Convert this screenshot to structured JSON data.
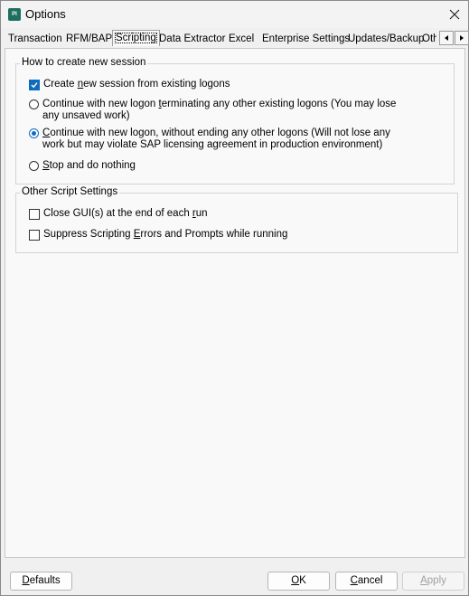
{
  "window": {
    "title": "Options",
    "app_icon_text": "PI"
  },
  "tabs": [
    {
      "label": "Transaction"
    },
    {
      "label": "RFM/BAPI"
    },
    {
      "label": "Scripting"
    },
    {
      "label": "Data Extractor"
    },
    {
      "label": "Excel"
    },
    {
      "label": "Enterprise Settings"
    },
    {
      "label": "Updates/Backup"
    },
    {
      "label": "Oth"
    }
  ],
  "active_tab": "Scripting",
  "session_group": {
    "title": "How to create new session",
    "options": [
      {
        "pre": "Create ",
        "key": "n",
        "post": "ew session from existing logons",
        "type": "checkbox",
        "selected": true
      },
      {
        "pre": "Continue with new logon ",
        "key": "t",
        "post": "erminating any other existing logons (You may lose any unsaved work)",
        "type": "radio",
        "selected": false
      },
      {
        "pre": "",
        "key": "C",
        "post": "ontinue with new logon, without ending any other logons (Will not lose any work but may violate SAP licensing agreement in production environment)",
        "type": "radio",
        "selected": true
      },
      {
        "pre": "",
        "key": "S",
        "post": "top and do nothing",
        "type": "radio",
        "selected": false
      }
    ]
  },
  "script_group": {
    "title": "Other Script Settings",
    "options": [
      {
        "pre": "Close GUI(s) at the end of each ",
        "key": "r",
        "post": "un",
        "checked": false
      },
      {
        "pre": "Suppress Scripting ",
        "key": "E",
        "post": "rrors and Prompts while running",
        "checked": false
      }
    ]
  },
  "buttons": {
    "defaults": {
      "key": "D",
      "post": "efaults"
    },
    "ok": {
      "key": "O",
      "post": "K"
    },
    "cancel": {
      "key": "C",
      "post": "ancel"
    },
    "apply": {
      "key": "A",
      "post": "pply",
      "enabled": false
    }
  },
  "colors": {
    "accent": "#0f6cbd",
    "background": "#f0f0f0"
  }
}
